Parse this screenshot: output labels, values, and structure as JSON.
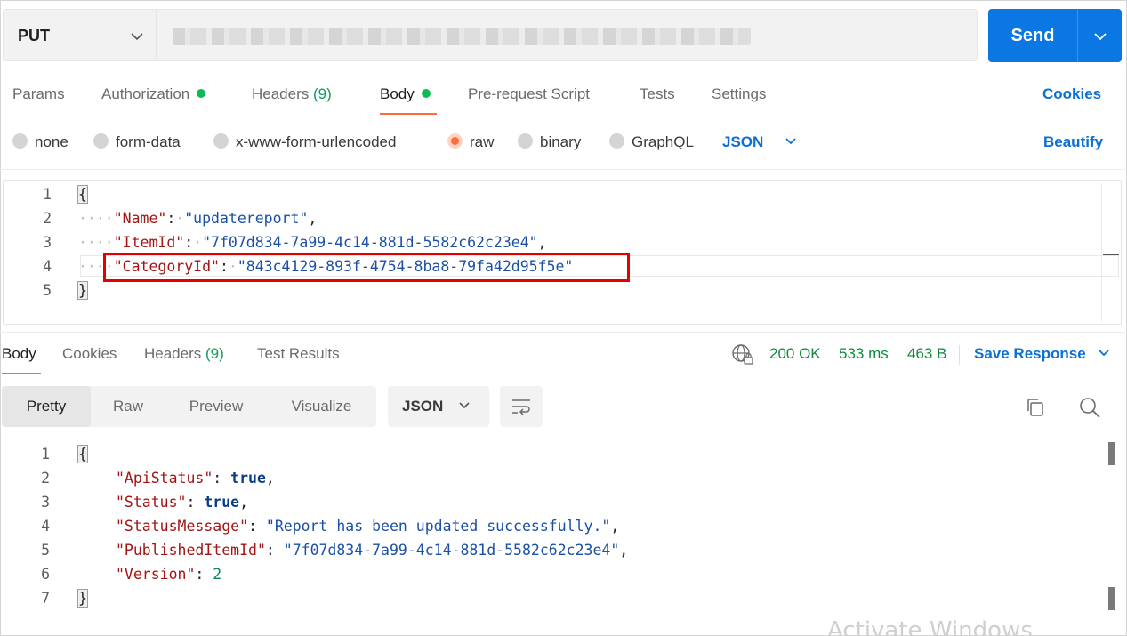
{
  "request": {
    "method": "PUT",
    "send_label": "Send"
  },
  "request_tabs": [
    {
      "label": "Params"
    },
    {
      "label": "Authorization"
    },
    {
      "label": "Headers",
      "count": "(9)"
    },
    {
      "label": "Body"
    },
    {
      "label": "Pre-request Script"
    },
    {
      "label": "Tests"
    },
    {
      "label": "Settings"
    }
  ],
  "cookies_link": "Cookies",
  "body_types": [
    "none",
    "form-data",
    "x-www-form-urlencoded",
    "raw",
    "binary",
    "GraphQL"
  ],
  "selected_body_type": "raw",
  "language": "JSON",
  "beautify_label": "Beautify",
  "request_body": {
    "line_numbers": [
      "1",
      "2",
      "3",
      "4",
      "5"
    ],
    "open_brace": "{",
    "close_brace": "}",
    "fields": [
      {
        "key": "\"Name\"",
        "value": "\"updatereport\"",
        "comma": ","
      },
      {
        "key": "\"ItemId\"",
        "value": "\"7f07d834-7a99-4c14-881d-5582c62c23e4\"",
        "comma": ","
      },
      {
        "key": "\"CategoryId\"",
        "value": "\"843c4129-893f-4754-8ba8-79fa42d95f5e\"",
        "comma": ""
      }
    ]
  },
  "response_tabs": [
    {
      "label": "Body"
    },
    {
      "label": "Cookies"
    },
    {
      "label": "Headers",
      "count": "(9)"
    },
    {
      "label": "Test Results"
    }
  ],
  "response_status": {
    "code": "200 OK",
    "time": "533 ms",
    "size": "463 B",
    "save_label": "Save Response"
  },
  "view_modes": [
    "Pretty",
    "Raw",
    "Preview",
    "Visualize"
  ],
  "response_format": "JSON",
  "response_body": {
    "line_numbers": [
      "1",
      "2",
      "3",
      "4",
      "5",
      "6",
      "7"
    ],
    "open_brace": "{",
    "close_brace": "}",
    "fields": [
      {
        "key": "\"ApiStatus\"",
        "value": "true",
        "kind": "bool",
        "comma": ","
      },
      {
        "key": "\"Status\"",
        "value": "true",
        "kind": "bool",
        "comma": ","
      },
      {
        "key": "\"StatusMessage\"",
        "value": "\"Report has been updated successfully.\"",
        "kind": "str",
        "comma": ","
      },
      {
        "key": "\"PublishedItemId\"",
        "value": "\"7f07d834-7a99-4c14-881d-5582c62c23e4\"",
        "kind": "str",
        "comma": ","
      },
      {
        "key": "\"Version\"",
        "value": "2",
        "kind": "num",
        "comma": ""
      }
    ]
  },
  "watermark": "Activate Windows",
  "colors": {
    "accent_orange": "#ff6c37",
    "send_blue": "#0b77e3",
    "link_blue": "#0b6fd4",
    "status_green": "#0f8a3e",
    "highlight_red": "#e50000"
  }
}
